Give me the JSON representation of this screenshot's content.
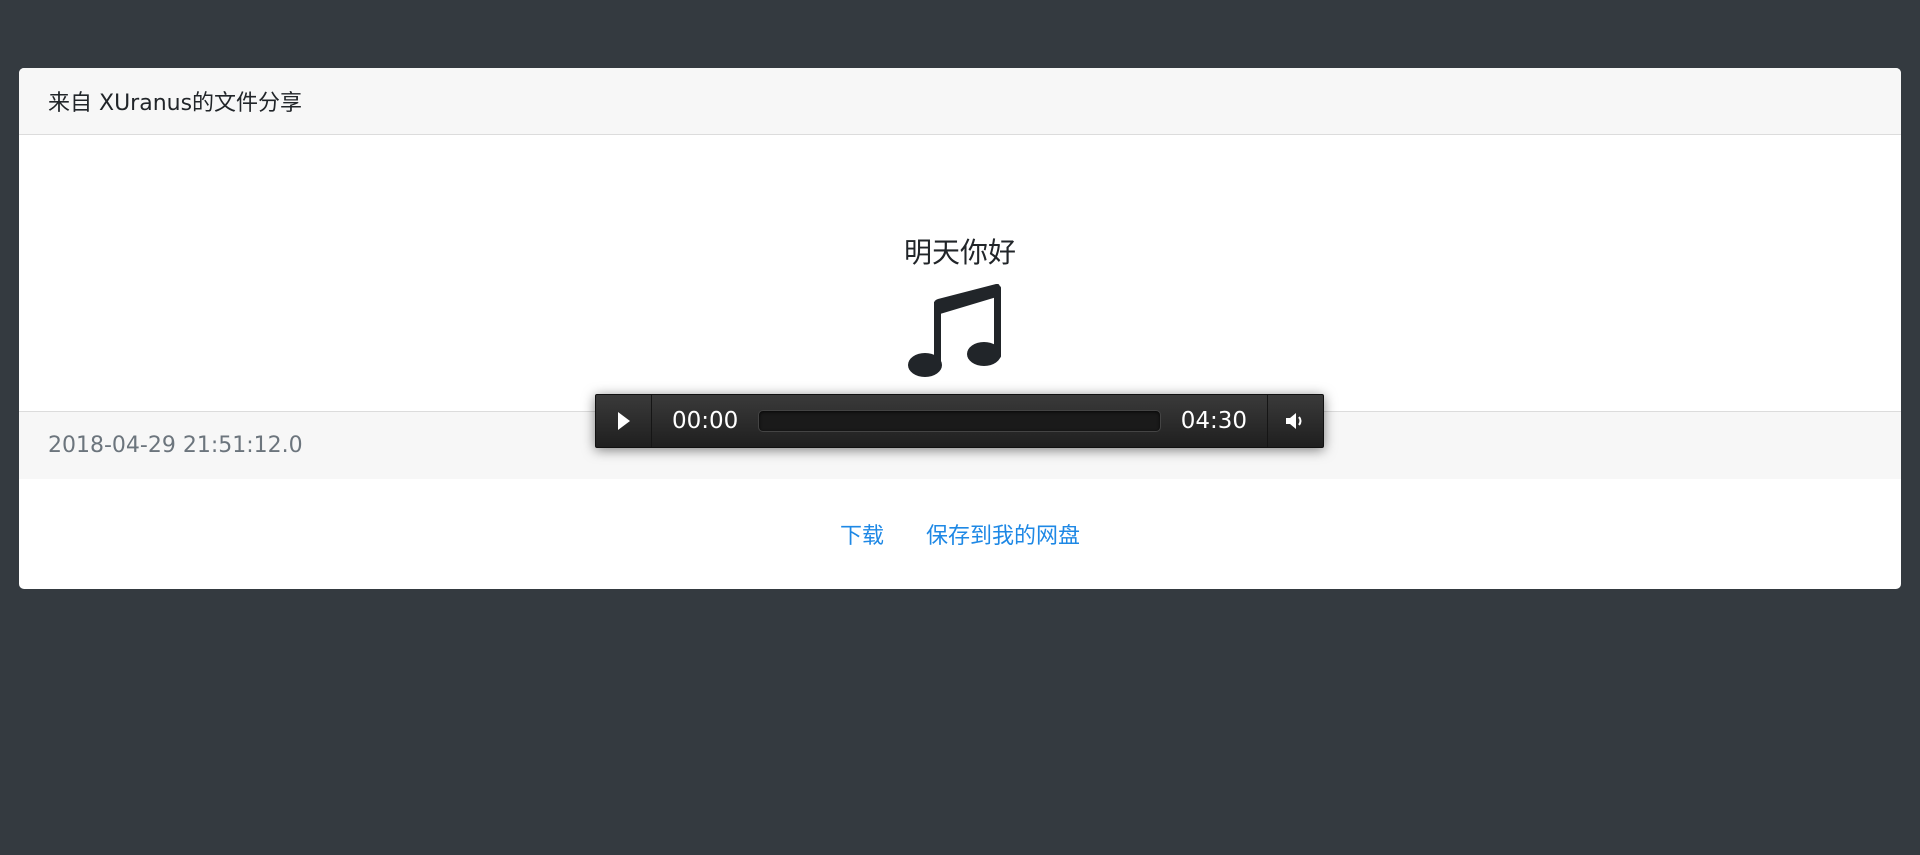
{
  "header": {
    "title": "来自 XUranus的文件分享"
  },
  "file": {
    "name": "明天你好",
    "icon": "music-note-icon"
  },
  "player": {
    "current_time": "00:00",
    "duration": "04:30",
    "progress": 0,
    "play_icon": "play-icon",
    "volume_icon": "volume-icon"
  },
  "footer": {
    "timestamp": "2018-04-29 21:51:12.0"
  },
  "actions": {
    "download_label": "下载",
    "save_label": "保存到我的网盘"
  },
  "colors": {
    "background": "#343a40",
    "link": "#1e88e5",
    "header_bg": "#f7f7f7"
  }
}
